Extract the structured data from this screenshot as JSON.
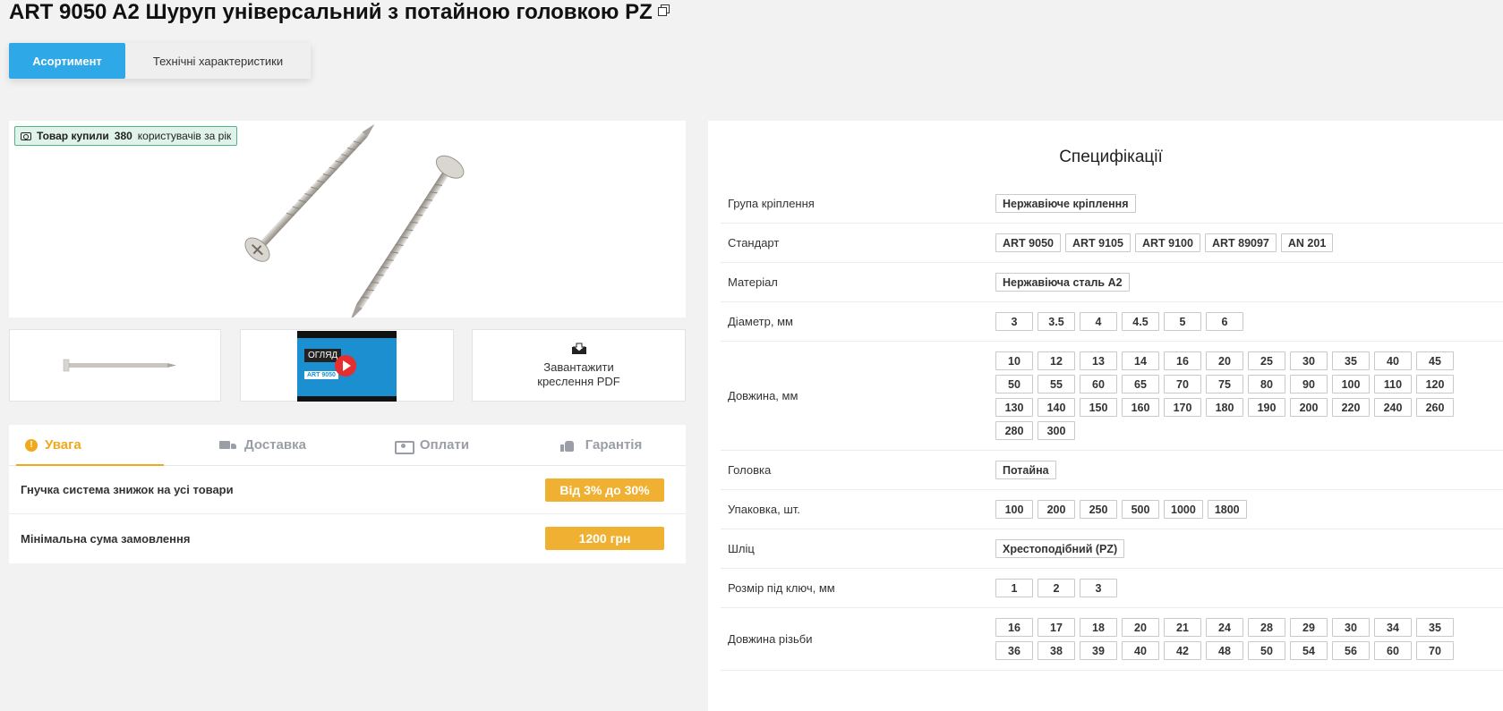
{
  "title": "ART 9050 A2 Шуруп універсальний з потайною головкою PZ",
  "tabs": {
    "assortment": "Асортимент",
    "specs_tab": "Технічні характеристики"
  },
  "promo": {
    "prefix": "Товар купили",
    "count": "380",
    "suffix": "користувачів за рік"
  },
  "video": {
    "label": "ОГЛЯД",
    "subtitle": "ART 9050"
  },
  "download": {
    "line1": "Завантажити",
    "line2": "креслення PDF"
  },
  "info_tabs": [
    "Увага",
    "Доставка",
    "Оплати",
    "Гарантія"
  ],
  "info_rows": [
    {
      "label": "Гнучка система знижок на усі товари",
      "value": "Від 3% до 30%"
    },
    {
      "label": "Мінімальна сума замовлення",
      "value": "1200 грн"
    }
  ],
  "specs": {
    "heading": "Специфікації",
    "rows": [
      {
        "key": "Група кріплення",
        "values": [
          "Нержавіюче кріплення"
        ]
      },
      {
        "key": "Стандарт",
        "values": [
          "ART 9050",
          "ART 9105",
          "ART 9100",
          "ART 89097",
          "AN 201"
        ]
      },
      {
        "key": "Матеріал",
        "values": [
          "Нержавіюча сталь А2"
        ]
      },
      {
        "key": "Діаметр, мм",
        "values": [
          "3",
          "3.5",
          "4",
          "4.5",
          "5",
          "6"
        ]
      },
      {
        "key": "Довжина, мм",
        "values": [
          "10",
          "12",
          "13",
          "14",
          "16",
          "20",
          "25",
          "30",
          "35",
          "40",
          "45",
          "50",
          "55",
          "60",
          "65",
          "70",
          "75",
          "80",
          "90",
          "100",
          "110",
          "120",
          "130",
          "140",
          "150",
          "160",
          "170",
          "180",
          "190",
          "200",
          "220",
          "240",
          "260",
          "280",
          "300"
        ]
      },
      {
        "key": "Головка",
        "values": [
          "Потайна"
        ]
      },
      {
        "key": "Упаковка, шт.",
        "values": [
          "100",
          "200",
          "250",
          "500",
          "1000",
          "1800"
        ]
      },
      {
        "key": "Шліц",
        "values": [
          "Хрестоподібний (PZ)"
        ]
      },
      {
        "key": "Розмір під ключ, мм",
        "values": [
          "1",
          "2",
          "3"
        ]
      },
      {
        "key": "Довжина різьби",
        "values": [
          "16",
          "17",
          "18",
          "20",
          "21",
          "24",
          "28",
          "29",
          "30",
          "34",
          "35",
          "36",
          "38",
          "39",
          "40",
          "42",
          "48",
          "50",
          "54",
          "56",
          "60",
          "70"
        ]
      }
    ]
  },
  "colors": {
    "accent_blue": "#2ea8e6",
    "accent_orange": "#f0a81c",
    "badge_green": "#53b48a"
  }
}
